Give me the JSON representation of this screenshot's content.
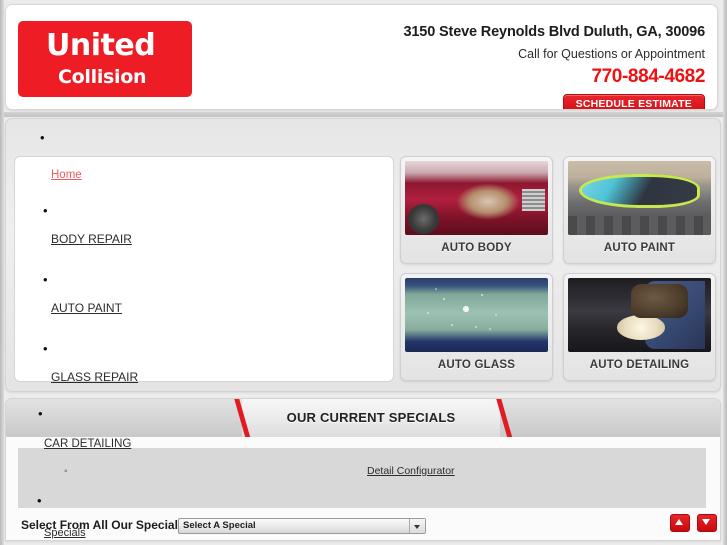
{
  "header": {
    "logo_line1": "United",
    "logo_line2": "Collision",
    "address": "3150 Steve Reynolds Blvd Duluth, GA, 30096",
    "call_text": "Call for Questions or Appointment",
    "phone": "770-884-4682",
    "schedule_button": "SCHEDULE ESTIMATE",
    "brand_red": "#ee1c25",
    "phone_red": "#ee1111"
  },
  "nav": {
    "items": [
      {
        "label": "Home",
        "bullet": ""
      },
      {
        "label": "BODY REPAIR",
        "bullet": "•"
      },
      {
        "label": "AUTO PAINT",
        "bullet": "•"
      },
      {
        "label": "GLASS REPAIR",
        "bullet": "•"
      }
    ],
    "stray_bullet": "•"
  },
  "tiles": [
    {
      "caption": "AUTO BODY",
      "art": "damaged-red-car-photo"
    },
    {
      "caption": "AUTO PAINT",
      "art": "masked-car-in-paint-booth-photo"
    },
    {
      "caption": "AUTO GLASS",
      "art": "cracked-windshield-photo"
    },
    {
      "caption": "AUTO DETAILING",
      "art": "hand-polishing-car-photo"
    }
  ],
  "specials": {
    "banner_title": "OUR CURRENT SPECIALS",
    "stray_bullet": "•",
    "category": "CAR DETAILING",
    "sub_bullet": "◦",
    "configurator_link": "Detail Configurator",
    "lower_bullet": "•",
    "footer_label": "Select From All Our Specials",
    "footer_link": "Specials",
    "select_value": "Select A Special",
    "select_options": [
      "Select A Special"
    ],
    "scroll_up": "▲",
    "scroll_down": "▼",
    "accent_red": "#e01b22"
  }
}
